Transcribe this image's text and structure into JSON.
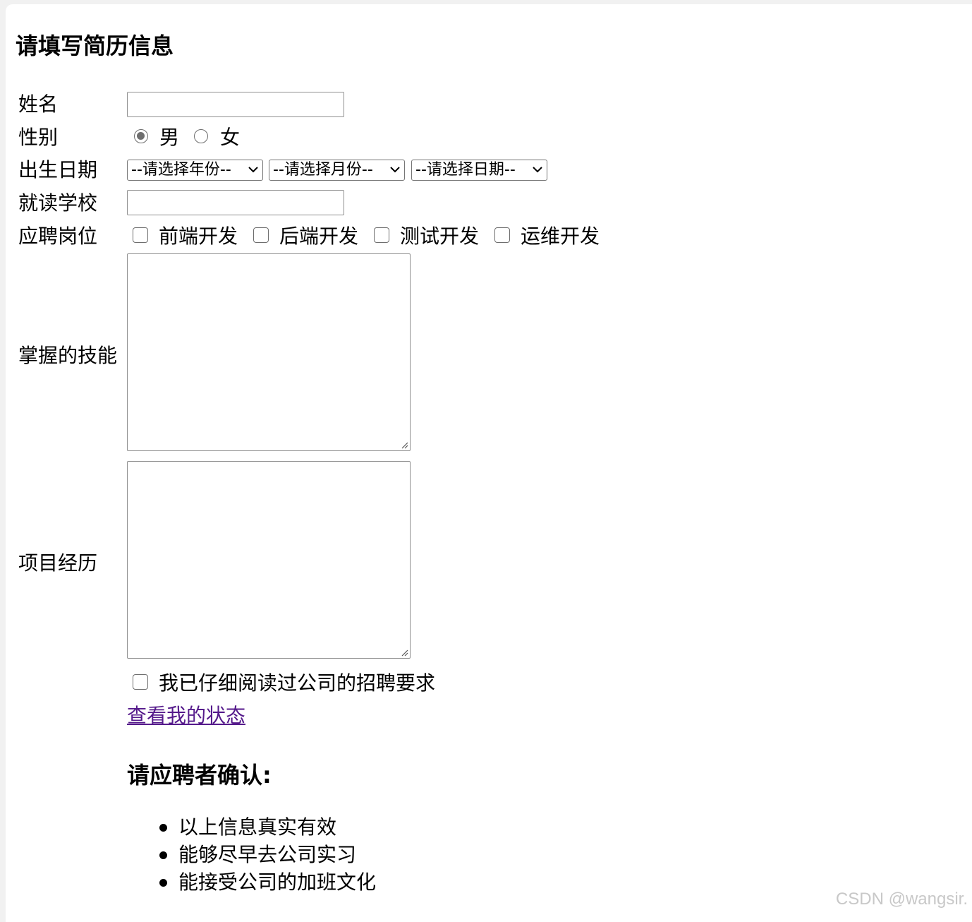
{
  "heading": "请填写简历信息",
  "form": {
    "name_label": "姓名",
    "name_value": "",
    "gender_label": "性别",
    "gender_options": [
      "男",
      "女"
    ],
    "gender_selected": "男",
    "birthdate_label": "出生日期",
    "year_select": "--请选择年份--",
    "month_select": "--请选择月份--",
    "day_select": "--请选择日期--",
    "school_label": "就读学校",
    "school_value": "",
    "position_label": "应聘岗位",
    "positions": [
      "前端开发",
      "后端开发",
      "测试开发",
      "运维开发"
    ],
    "skills_label": "掌握的技能",
    "skills_value": "",
    "projects_label": "项目经历",
    "projects_value": "",
    "agree_label": "我已仔细阅读过公司的招聘要求",
    "status_link": "查看我的状态"
  },
  "confirm": {
    "title": "请应聘者确认:",
    "items": [
      "以上信息真实有效",
      "能够尽早去公司实习",
      "能接受公司的加班文化"
    ]
  },
  "watermark": "CSDN @wangsir."
}
